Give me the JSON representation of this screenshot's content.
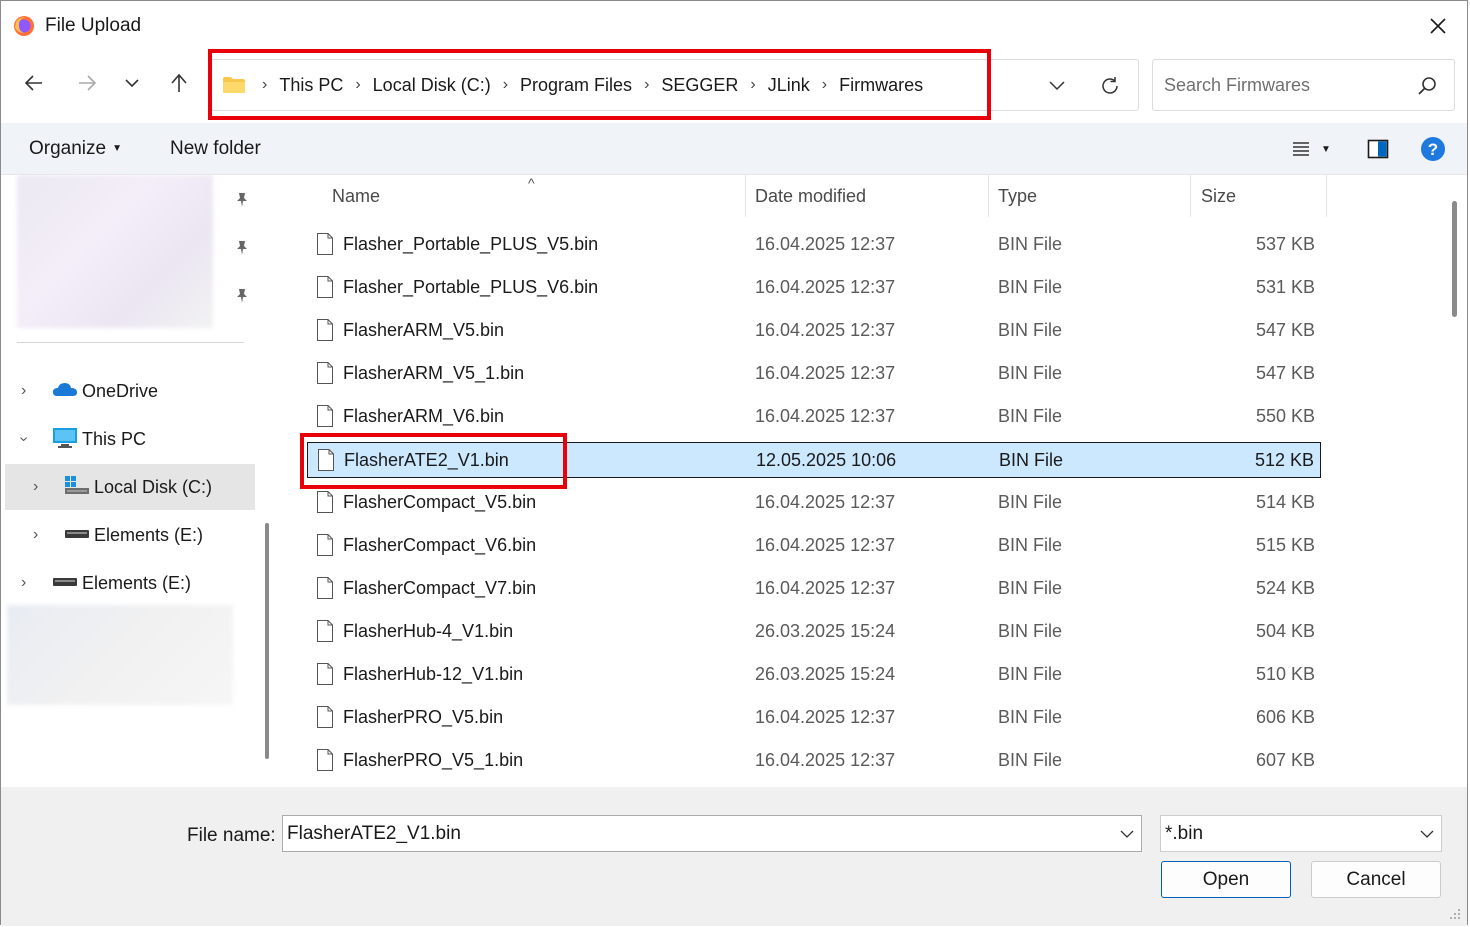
{
  "window": {
    "title": "File Upload",
    "close_icon": "close-icon",
    "app_icon": "firefox-icon"
  },
  "nav": {
    "back_icon": "back-arrow-icon",
    "forward_icon": "forward-arrow-icon",
    "recent_icon": "chevron-down-icon",
    "up_icon": "up-arrow-icon"
  },
  "address": {
    "folder_icon": "folder-icon",
    "breadcrumb": [
      "This PC",
      "Local Disk (C:)",
      "Program Files",
      "SEGGER",
      "JLink",
      "Firmwares"
    ]
  },
  "search": {
    "placeholder": "Search Firmwares"
  },
  "toolbar": {
    "organize_label": "Organize",
    "new_folder_label": "New folder"
  },
  "sidebar": {
    "items": [
      {
        "label": "OneDrive",
        "icon": "onedrive-icon"
      },
      {
        "label": "This PC",
        "icon": "pc-icon"
      },
      {
        "label": "Local Disk (C:)",
        "icon": "drive-icon",
        "selected": true
      },
      {
        "label": "Elements (E:)",
        "icon": "external-drive-icon"
      },
      {
        "label": "Elements (E:)",
        "icon": "external-drive-icon"
      }
    ]
  },
  "columns": {
    "name": "Name",
    "date": "Date modified",
    "type": "Type",
    "size": "Size"
  },
  "files": [
    {
      "name": "Flasher_Portable_PLUS_V5.bin",
      "date": "16.04.2025 12:37",
      "type": "BIN File",
      "size": "537 KB"
    },
    {
      "name": "Flasher_Portable_PLUS_V6.bin",
      "date": "16.04.2025 12:37",
      "type": "BIN File",
      "size": "531 KB"
    },
    {
      "name": "FlasherARM_V5.bin",
      "date": "16.04.2025 12:37",
      "type": "BIN File",
      "size": "547 KB"
    },
    {
      "name": "FlasherARM_V5_1.bin",
      "date": "16.04.2025 12:37",
      "type": "BIN File",
      "size": "547 KB"
    },
    {
      "name": "FlasherARM_V6.bin",
      "date": "16.04.2025 12:37",
      "type": "BIN File",
      "size": "550 KB"
    },
    {
      "name": "FlasherATE2_V1.bin",
      "date": "12.05.2025 10:06",
      "type": "BIN File",
      "size": "512 KB",
      "selected": true
    },
    {
      "name": "FlasherCompact_V5.bin",
      "date": "16.04.2025 12:37",
      "type": "BIN File",
      "size": "514 KB"
    },
    {
      "name": "FlasherCompact_V6.bin",
      "date": "16.04.2025 12:37",
      "type": "BIN File",
      "size": "515 KB"
    },
    {
      "name": "FlasherCompact_V7.bin",
      "date": "16.04.2025 12:37",
      "type": "BIN File",
      "size": "524 KB"
    },
    {
      "name": "FlasherHub-4_V1.bin",
      "date": "26.03.2025 15:24",
      "type": "BIN File",
      "size": "504 KB"
    },
    {
      "name": "FlasherHub-12_V1.bin",
      "date": "26.03.2025 15:24",
      "type": "BIN File",
      "size": "510 KB"
    },
    {
      "name": "FlasherPRO_V5.bin",
      "date": "16.04.2025 12:37",
      "type": "BIN File",
      "size": "606 KB"
    },
    {
      "name": "FlasherPRO_V5_1.bin",
      "date": "16.04.2025 12:37",
      "type": "BIN File",
      "size": "607 KB"
    }
  ],
  "footer": {
    "filename_label": "File name:",
    "filename_value": "FlasherATE2_V1.bin",
    "filter_value": "*.bin",
    "open_label": "Open",
    "cancel_label": "Cancel"
  },
  "colors": {
    "highlight": "#e8000b",
    "selection": "#cce8ff",
    "accent": "#005fb8"
  }
}
